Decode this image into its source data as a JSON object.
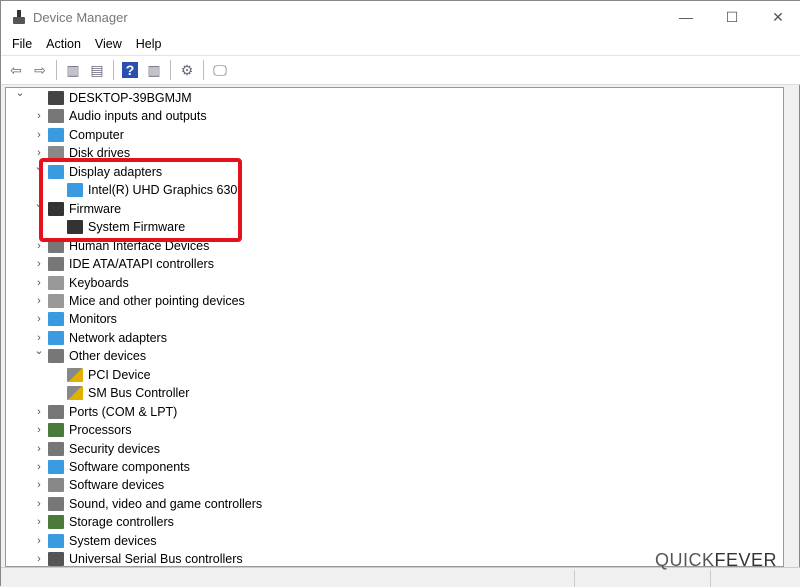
{
  "window": {
    "title": "Device Manager",
    "minimize": "—",
    "maximize": "☐",
    "close": "✕"
  },
  "menu": [
    "File",
    "Action",
    "View",
    "Help"
  ],
  "toolbar": [
    {
      "icon": "back-icon",
      "glyph": "⇦"
    },
    {
      "icon": "forward-icon",
      "glyph": "⇨"
    },
    {
      "icon": "show-hide-console-tree-icon",
      "glyph": "▥"
    },
    {
      "icon": "properties-icon",
      "glyph": "▤"
    },
    {
      "icon": "help-icon",
      "glyph": "?"
    },
    {
      "icon": "run-action-icon",
      "glyph": "▥"
    },
    {
      "icon": "update-driver-icon",
      "glyph": "⚙"
    },
    {
      "icon": "scan-hardware-icon",
      "glyph": "🖵"
    }
  ],
  "tree": [
    {
      "level": 0,
      "label": "DESKTOP-39BGMJM",
      "expanded": true,
      "icon": "computer-icon",
      "color": "#444"
    },
    {
      "level": 1,
      "label": "Audio inputs and outputs",
      "icon": "speaker-icon",
      "color": "#777"
    },
    {
      "level": 1,
      "label": "Computer",
      "icon": "monitor-icon",
      "color": "#3a9be0"
    },
    {
      "level": 1,
      "label": "Disk drives",
      "icon": "disk-icon",
      "color": "#888"
    },
    {
      "level": 1,
      "label": "Display adapters",
      "expanded": true,
      "icon": "display-adapter-icon",
      "color": "#3a9be0"
    },
    {
      "level": 2,
      "label": "Intel(R) UHD Graphics 630",
      "icon": "display-adapter-icon",
      "color": "#3a9be0"
    },
    {
      "level": 1,
      "label": "Firmware",
      "expanded": true,
      "icon": "firmware-icon",
      "color": "#333"
    },
    {
      "level": 2,
      "label": "System Firmware",
      "icon": "firmware-icon",
      "color": "#333"
    },
    {
      "level": 1,
      "label": "Human Interface Devices",
      "icon": "hid-icon",
      "color": "#777"
    },
    {
      "level": 1,
      "label": "IDE ATA/ATAPI controllers",
      "icon": "ide-icon",
      "color": "#777"
    },
    {
      "level": 1,
      "label": "Keyboards",
      "icon": "keyboard-icon",
      "color": "#999"
    },
    {
      "level": 1,
      "label": "Mice and other pointing devices",
      "icon": "mouse-icon",
      "color": "#999"
    },
    {
      "level": 1,
      "label": "Monitors",
      "icon": "monitor-icon",
      "color": "#3a9be0"
    },
    {
      "level": 1,
      "label": "Network adapters",
      "icon": "network-icon",
      "color": "#3a9be0"
    },
    {
      "level": 1,
      "label": "Other devices",
      "expanded": true,
      "icon": "unknown-device-icon",
      "color": "#777"
    },
    {
      "level": 2,
      "label": "PCI Device",
      "icon": "warning-icon",
      "color": "#e0b000"
    },
    {
      "level": 2,
      "label": "SM Bus Controller",
      "icon": "warning-icon",
      "color": "#e0b000"
    },
    {
      "level": 1,
      "label": "Ports (COM & LPT)",
      "icon": "port-icon",
      "color": "#777"
    },
    {
      "level": 1,
      "label": "Processors",
      "icon": "processor-icon",
      "color": "#4a7a3a"
    },
    {
      "level": 1,
      "label": "Security devices",
      "icon": "security-icon",
      "color": "#777"
    },
    {
      "level": 1,
      "label": "Software components",
      "icon": "software-component-icon",
      "color": "#3a9be0"
    },
    {
      "level": 1,
      "label": "Software devices",
      "icon": "software-device-icon",
      "color": "#888"
    },
    {
      "level": 1,
      "label": "Sound, video and game controllers",
      "icon": "speaker-icon",
      "color": "#777"
    },
    {
      "level": 1,
      "label": "Storage controllers",
      "icon": "storage-icon",
      "color": "#4a7a3a"
    },
    {
      "level": 1,
      "label": "System devices",
      "icon": "system-devices-icon",
      "color": "#3a9be0"
    },
    {
      "level": 1,
      "label": "Universal Serial Bus controllers",
      "icon": "usb-icon",
      "color": "#555"
    }
  ],
  "highlight_color": "#e8101a",
  "watermark": {
    "a": "QUICK",
    "b": "FEVER"
  }
}
